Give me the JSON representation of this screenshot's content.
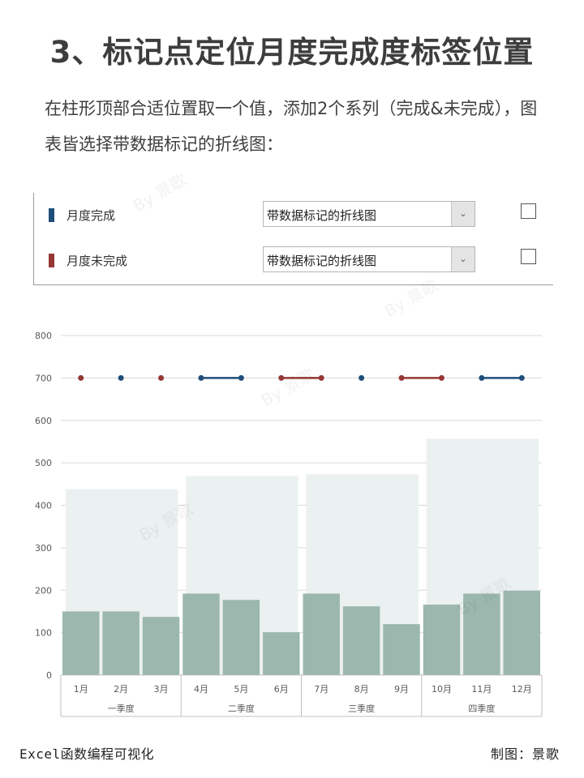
{
  "title": "3、标记点定位月度完成度标签位置",
  "subtitle": "在柱形顶部合适位置取一个值，添加2个系列（完成&未完成），图表皆选择带数据标记的折线图：",
  "panel": {
    "rows": [
      {
        "name": "月度完成",
        "chart_type": "带数据标记的折线图",
        "color": "#1f4e79",
        "dropdown_icon": "chevron-down-icon"
      },
      {
        "name": "月度未完成",
        "chart_type": "带数据标记的折线图",
        "color": "#953735",
        "dropdown_icon": "chevron-down-icon"
      }
    ]
  },
  "watermark": "By 景歌",
  "footer": {
    "left": "Excel函数编程可视化",
    "right": "制图：景歌"
  },
  "chart_data": {
    "type": "bar",
    "ylim": [
      0,
      800
    ],
    "yticks": [
      0,
      100,
      200,
      300,
      400,
      500,
      600,
      700,
      800
    ],
    "grid": true,
    "categories": [
      "1月",
      "2月",
      "3月",
      "4月",
      "5月",
      "6月",
      "7月",
      "8月",
      "9月",
      "10月",
      "11月",
      "12月"
    ],
    "groups": [
      {
        "label": "一季度",
        "total": 438
      },
      {
        "label": "二季度",
        "total": 469
      },
      {
        "label": "三季度",
        "total": 473
      },
      {
        "label": "四季度",
        "total": 557
      }
    ],
    "values": [
      150,
      150,
      137,
      192,
      177,
      101,
      192,
      162,
      120,
      166,
      192,
      199
    ],
    "marker_value": 700,
    "series": [
      {
        "name": "月度完成",
        "color": "#1f4e79",
        "values": [
          null,
          700,
          null,
          700,
          700,
          null,
          null,
          700,
          null,
          null,
          700,
          700
        ]
      },
      {
        "name": "月度未完成",
        "color": "#953735",
        "values": [
          700,
          null,
          700,
          null,
          null,
          700,
          700,
          null,
          700,
          700,
          null,
          null
        ]
      }
    ],
    "colors": {
      "bar": "#9bb7ae",
      "group_bar": "#ebf0f0",
      "grid": "#d9d9d9",
      "axis_text": "#595959"
    }
  }
}
